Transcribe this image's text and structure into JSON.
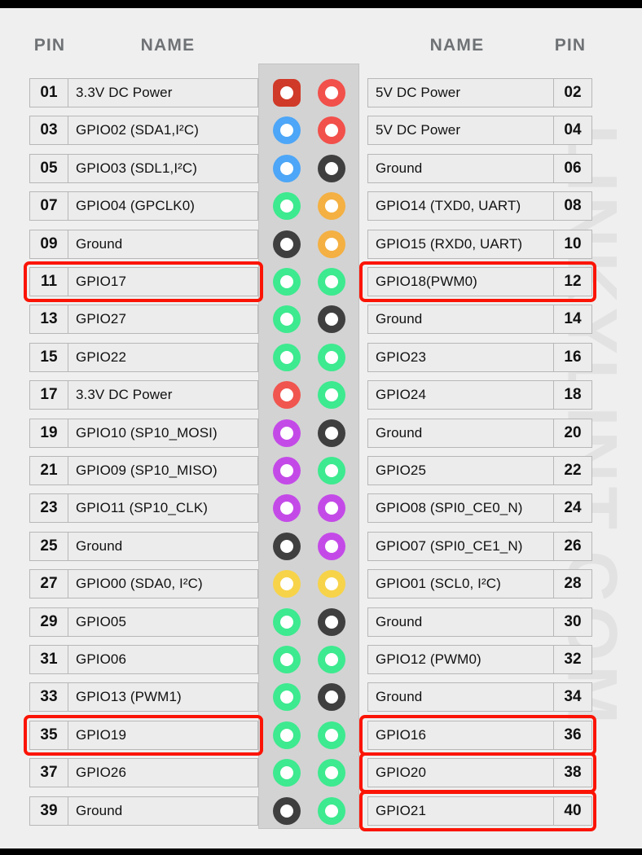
{
  "watermark": "LINKYLINT.COM",
  "header": {
    "pin_left": "PIN",
    "name_left": "NAME",
    "name_right": "NAME",
    "pin_right": "PIN"
  },
  "palette": {
    "power_33v": "#f0564f",
    "power_33v_pin1": "#d03a28",
    "power_5v": "#f2504b",
    "ground": "#3f3f3f",
    "i2c": "#4da6f7",
    "gpio": "#3dea8f",
    "uart": "#f4b042",
    "spi": "#c44ae8",
    "i2c0": "#f7d34a",
    "highlight": "#fb1405",
    "strip": "#d3d3d3",
    "page_bg": "#efefef",
    "cell_bg": "#ececec",
    "cell_border": "#b7b7b7",
    "header_text": "#6f7275"
  },
  "rows": [
    {
      "pin_left": "01",
      "name_left": "3.3V DC Power",
      "color_left": "power_33v_pin1",
      "shape_left": "square",
      "pin_right": "02",
      "name_right": "5V DC Power",
      "color_right": "power_5v",
      "shape_right": "circle",
      "hl_left": false,
      "hl_right": false
    },
    {
      "pin_left": "03",
      "name_left": "GPIO02 (SDA1,I²C)",
      "color_left": "i2c",
      "shape_left": "circle",
      "pin_right": "04",
      "name_right": "5V DC Power",
      "color_right": "power_5v",
      "shape_right": "circle",
      "hl_left": false,
      "hl_right": false
    },
    {
      "pin_left": "05",
      "name_left": "GPIO03 (SDL1,I²C)",
      "color_left": "i2c",
      "shape_left": "circle",
      "pin_right": "06",
      "name_right": "Ground",
      "color_right": "ground",
      "shape_right": "circle",
      "hl_left": false,
      "hl_right": false
    },
    {
      "pin_left": "07",
      "name_left": "GPIO04 (GPCLK0)",
      "color_left": "gpio",
      "shape_left": "circle",
      "pin_right": "08",
      "name_right": "GPIO14 (TXD0, UART)",
      "color_right": "uart",
      "shape_right": "circle",
      "hl_left": false,
      "hl_right": false
    },
    {
      "pin_left": "09",
      "name_left": "Ground",
      "color_left": "ground",
      "shape_left": "circle",
      "pin_right": "10",
      "name_right": "GPIO15 (RXD0, UART)",
      "color_right": "uart",
      "shape_right": "circle",
      "hl_left": false,
      "hl_right": false
    },
    {
      "pin_left": "11",
      "name_left": "GPIO17",
      "color_left": "gpio",
      "shape_left": "circle",
      "pin_right": "12",
      "name_right": "GPIO18(PWM0)",
      "color_right": "gpio",
      "shape_right": "circle",
      "hl_left": true,
      "hl_right": true
    },
    {
      "pin_left": "13",
      "name_left": "GPIO27",
      "color_left": "gpio",
      "shape_left": "circle",
      "pin_right": "14",
      "name_right": "Ground",
      "color_right": "ground",
      "shape_right": "circle",
      "hl_left": false,
      "hl_right": false
    },
    {
      "pin_left": "15",
      "name_left": "GPIO22",
      "color_left": "gpio",
      "shape_left": "circle",
      "pin_right": "16",
      "name_right": "GPIO23",
      "color_right": "gpio",
      "shape_right": "circle",
      "hl_left": false,
      "hl_right": false
    },
    {
      "pin_left": "17",
      "name_left": "3.3V DC Power",
      "color_left": "power_33v",
      "shape_left": "circle",
      "pin_right": "18",
      "name_right": "GPIO24",
      "color_right": "gpio",
      "shape_right": "circle",
      "hl_left": false,
      "hl_right": false
    },
    {
      "pin_left": "19",
      "name_left": "GPIO10 (SP10_MOSI)",
      "color_left": "spi",
      "shape_left": "circle",
      "pin_right": "20",
      "name_right": "Ground",
      "color_right": "ground",
      "shape_right": "circle",
      "hl_left": false,
      "hl_right": false
    },
    {
      "pin_left": "21",
      "name_left": "GPIO09 (SP10_MISO)",
      "color_left": "spi",
      "shape_left": "circle",
      "pin_right": "22",
      "name_right": "GPIO25",
      "color_right": "gpio",
      "shape_right": "circle",
      "hl_left": false,
      "hl_right": false
    },
    {
      "pin_left": "23",
      "name_left": "GPIO11 (SP10_CLK)",
      "color_left": "spi",
      "shape_left": "circle",
      "pin_right": "24",
      "name_right": "GPIO08 (SPI0_CE0_N)",
      "color_right": "spi",
      "shape_right": "circle",
      "hl_left": false,
      "hl_right": false
    },
    {
      "pin_left": "25",
      "name_left": "Ground",
      "color_left": "ground",
      "shape_left": "circle",
      "pin_right": "26",
      "name_right": "GPIO07 (SPI0_CE1_N)",
      "color_right": "spi",
      "shape_right": "circle",
      "hl_left": false,
      "hl_right": false
    },
    {
      "pin_left": "27",
      "name_left": "GPIO00 (SDA0, I²C)",
      "color_left": "i2c0",
      "shape_left": "circle",
      "pin_right": "28",
      "name_right": "GPIO01 (SCL0, I²C)",
      "color_right": "i2c0",
      "shape_right": "circle",
      "hl_left": false,
      "hl_right": false
    },
    {
      "pin_left": "29",
      "name_left": "GPIO05",
      "color_left": "gpio",
      "shape_left": "circle",
      "pin_right": "30",
      "name_right": "Ground",
      "color_right": "ground",
      "shape_right": "circle",
      "hl_left": false,
      "hl_right": false
    },
    {
      "pin_left": "31",
      "name_left": "GPIO06",
      "color_left": "gpio",
      "shape_left": "circle",
      "pin_right": "32",
      "name_right": "GPIO12 (PWM0)",
      "color_right": "gpio",
      "shape_right": "circle",
      "hl_left": false,
      "hl_right": false
    },
    {
      "pin_left": "33",
      "name_left": "GPIO13 (PWM1)",
      "color_left": "gpio",
      "shape_left": "circle",
      "pin_right": "34",
      "name_right": "Ground",
      "color_right": "ground",
      "shape_right": "circle",
      "hl_left": false,
      "hl_right": false
    },
    {
      "pin_left": "35",
      "name_left": "GPIO19",
      "color_left": "gpio",
      "shape_left": "circle",
      "pin_right": "36",
      "name_right": "GPIO16",
      "color_right": "gpio",
      "shape_right": "circle",
      "hl_left": true,
      "hl_right": true
    },
    {
      "pin_left": "37",
      "name_left": "GPIO26",
      "color_left": "gpio",
      "shape_left": "circle",
      "pin_right": "38",
      "name_right": "GPIO20",
      "color_right": "gpio",
      "shape_right": "circle",
      "hl_left": false,
      "hl_right": true
    },
    {
      "pin_left": "39",
      "name_left": "Ground",
      "color_left": "ground",
      "shape_left": "circle",
      "pin_right": "40",
      "name_right": "GPIO21",
      "color_right": "gpio",
      "shape_right": "circle",
      "hl_left": false,
      "hl_right": true
    }
  ]
}
